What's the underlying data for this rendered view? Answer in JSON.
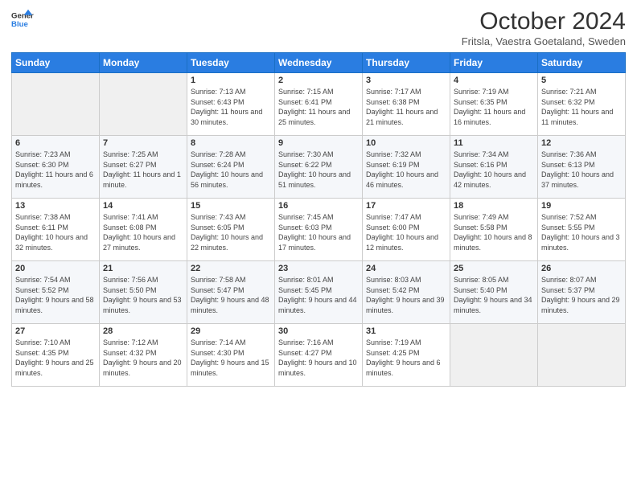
{
  "header": {
    "logo_general": "General",
    "logo_blue": "Blue",
    "title": "October 2024",
    "location": "Fritsla, Vaestra Goetaland, Sweden"
  },
  "days_of_week": [
    "Sunday",
    "Monday",
    "Tuesday",
    "Wednesday",
    "Thursday",
    "Friday",
    "Saturday"
  ],
  "weeks": [
    [
      {
        "day": "",
        "info": ""
      },
      {
        "day": "",
        "info": ""
      },
      {
        "day": "1",
        "info": "Sunrise: 7:13 AM\nSunset: 6:43 PM\nDaylight: 11 hours\nand 30 minutes."
      },
      {
        "day": "2",
        "info": "Sunrise: 7:15 AM\nSunset: 6:41 PM\nDaylight: 11 hours\nand 25 minutes."
      },
      {
        "day": "3",
        "info": "Sunrise: 7:17 AM\nSunset: 6:38 PM\nDaylight: 11 hours\nand 21 minutes."
      },
      {
        "day": "4",
        "info": "Sunrise: 7:19 AM\nSunset: 6:35 PM\nDaylight: 11 hours\nand 16 minutes."
      },
      {
        "day": "5",
        "info": "Sunrise: 7:21 AM\nSunset: 6:32 PM\nDaylight: 11 hours\nand 11 minutes."
      }
    ],
    [
      {
        "day": "6",
        "info": "Sunrise: 7:23 AM\nSunset: 6:30 PM\nDaylight: 11 hours\nand 6 minutes."
      },
      {
        "day": "7",
        "info": "Sunrise: 7:25 AM\nSunset: 6:27 PM\nDaylight: 11 hours\nand 1 minute."
      },
      {
        "day": "8",
        "info": "Sunrise: 7:28 AM\nSunset: 6:24 PM\nDaylight: 10 hours\nand 56 minutes."
      },
      {
        "day": "9",
        "info": "Sunrise: 7:30 AM\nSunset: 6:22 PM\nDaylight: 10 hours\nand 51 minutes."
      },
      {
        "day": "10",
        "info": "Sunrise: 7:32 AM\nSunset: 6:19 PM\nDaylight: 10 hours\nand 46 minutes."
      },
      {
        "day": "11",
        "info": "Sunrise: 7:34 AM\nSunset: 6:16 PM\nDaylight: 10 hours\nand 42 minutes."
      },
      {
        "day": "12",
        "info": "Sunrise: 7:36 AM\nSunset: 6:13 PM\nDaylight: 10 hours\nand 37 minutes."
      }
    ],
    [
      {
        "day": "13",
        "info": "Sunrise: 7:38 AM\nSunset: 6:11 PM\nDaylight: 10 hours\nand 32 minutes."
      },
      {
        "day": "14",
        "info": "Sunrise: 7:41 AM\nSunset: 6:08 PM\nDaylight: 10 hours\nand 27 minutes."
      },
      {
        "day": "15",
        "info": "Sunrise: 7:43 AM\nSunset: 6:05 PM\nDaylight: 10 hours\nand 22 minutes."
      },
      {
        "day": "16",
        "info": "Sunrise: 7:45 AM\nSunset: 6:03 PM\nDaylight: 10 hours\nand 17 minutes."
      },
      {
        "day": "17",
        "info": "Sunrise: 7:47 AM\nSunset: 6:00 PM\nDaylight: 10 hours\nand 12 minutes."
      },
      {
        "day": "18",
        "info": "Sunrise: 7:49 AM\nSunset: 5:58 PM\nDaylight: 10 hours\nand 8 minutes."
      },
      {
        "day": "19",
        "info": "Sunrise: 7:52 AM\nSunset: 5:55 PM\nDaylight: 10 hours\nand 3 minutes."
      }
    ],
    [
      {
        "day": "20",
        "info": "Sunrise: 7:54 AM\nSunset: 5:52 PM\nDaylight: 9 hours\nand 58 minutes."
      },
      {
        "day": "21",
        "info": "Sunrise: 7:56 AM\nSunset: 5:50 PM\nDaylight: 9 hours\nand 53 minutes."
      },
      {
        "day": "22",
        "info": "Sunrise: 7:58 AM\nSunset: 5:47 PM\nDaylight: 9 hours\nand 48 minutes."
      },
      {
        "day": "23",
        "info": "Sunrise: 8:01 AM\nSunset: 5:45 PM\nDaylight: 9 hours\nand 44 minutes."
      },
      {
        "day": "24",
        "info": "Sunrise: 8:03 AM\nSunset: 5:42 PM\nDaylight: 9 hours\nand 39 minutes."
      },
      {
        "day": "25",
        "info": "Sunrise: 8:05 AM\nSunset: 5:40 PM\nDaylight: 9 hours\nand 34 minutes."
      },
      {
        "day": "26",
        "info": "Sunrise: 8:07 AM\nSunset: 5:37 PM\nDaylight: 9 hours\nand 29 minutes."
      }
    ],
    [
      {
        "day": "27",
        "info": "Sunrise: 7:10 AM\nSunset: 4:35 PM\nDaylight: 9 hours\nand 25 minutes."
      },
      {
        "day": "28",
        "info": "Sunrise: 7:12 AM\nSunset: 4:32 PM\nDaylight: 9 hours\nand 20 minutes."
      },
      {
        "day": "29",
        "info": "Sunrise: 7:14 AM\nSunset: 4:30 PM\nDaylight: 9 hours\nand 15 minutes."
      },
      {
        "day": "30",
        "info": "Sunrise: 7:16 AM\nSunset: 4:27 PM\nDaylight: 9 hours\nand 10 minutes."
      },
      {
        "day": "31",
        "info": "Sunrise: 7:19 AM\nSunset: 4:25 PM\nDaylight: 9 hours\nand 6 minutes."
      },
      {
        "day": "",
        "info": ""
      },
      {
        "day": "",
        "info": ""
      }
    ]
  ]
}
